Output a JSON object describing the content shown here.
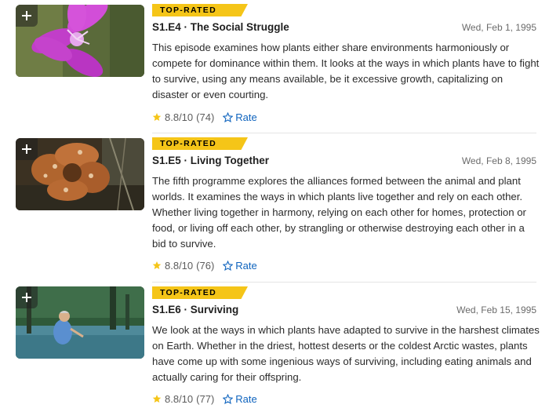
{
  "episodes": [
    {
      "badge": "TOP-RATED",
      "title": "S1.E4 · The Social Struggle",
      "date": "Wed, Feb 1, 1995",
      "description": "This episode examines how plants either share environments harmoniously or compete for dominance within them. It looks at the ways in which plants have to fight to survive, using any means available, be it excessive growth, capitalizing on disaster or even courting.",
      "rating": "8.8/10",
      "votes": "(74)",
      "rate_label": "Rate",
      "thumbnail": "pink-flower-image"
    },
    {
      "badge": "TOP-RATED",
      "title": "S1.E5 · Living Together",
      "date": "Wed, Feb 8, 1995",
      "description": "The fifth programme explores the alliances formed between the animal and plant worlds. It examines the ways in which plants live together and rely on each other. Whether living together in harmony, relying on each other for homes, protection or food, or living off each other, by strangling or otherwise destroying each other in a bid to survive.",
      "rating": "8.8/10",
      "votes": "(76)",
      "rate_label": "Rate",
      "thumbnail": "rafflesia-flower-image"
    },
    {
      "badge": "TOP-RATED",
      "title": "S1.E6 · Surviving",
      "date": "Wed, Feb 15, 1995",
      "description": "We look at the ways in which plants have adapted to survive in the harshest climates on Earth. Whether in the driest, hottest deserts or the coldest Arctic wastes, plants have come up with some ingenious ways of surviving, including eating animals and actually caring for their offspring.",
      "rating": "8.8/10",
      "votes": "(77)",
      "rate_label": "Rate",
      "thumbnail": "man-in-swamp-image"
    }
  ],
  "colors": {
    "badge_bg": "#f5c518",
    "star": "#f5c518",
    "link": "#0e63be"
  }
}
